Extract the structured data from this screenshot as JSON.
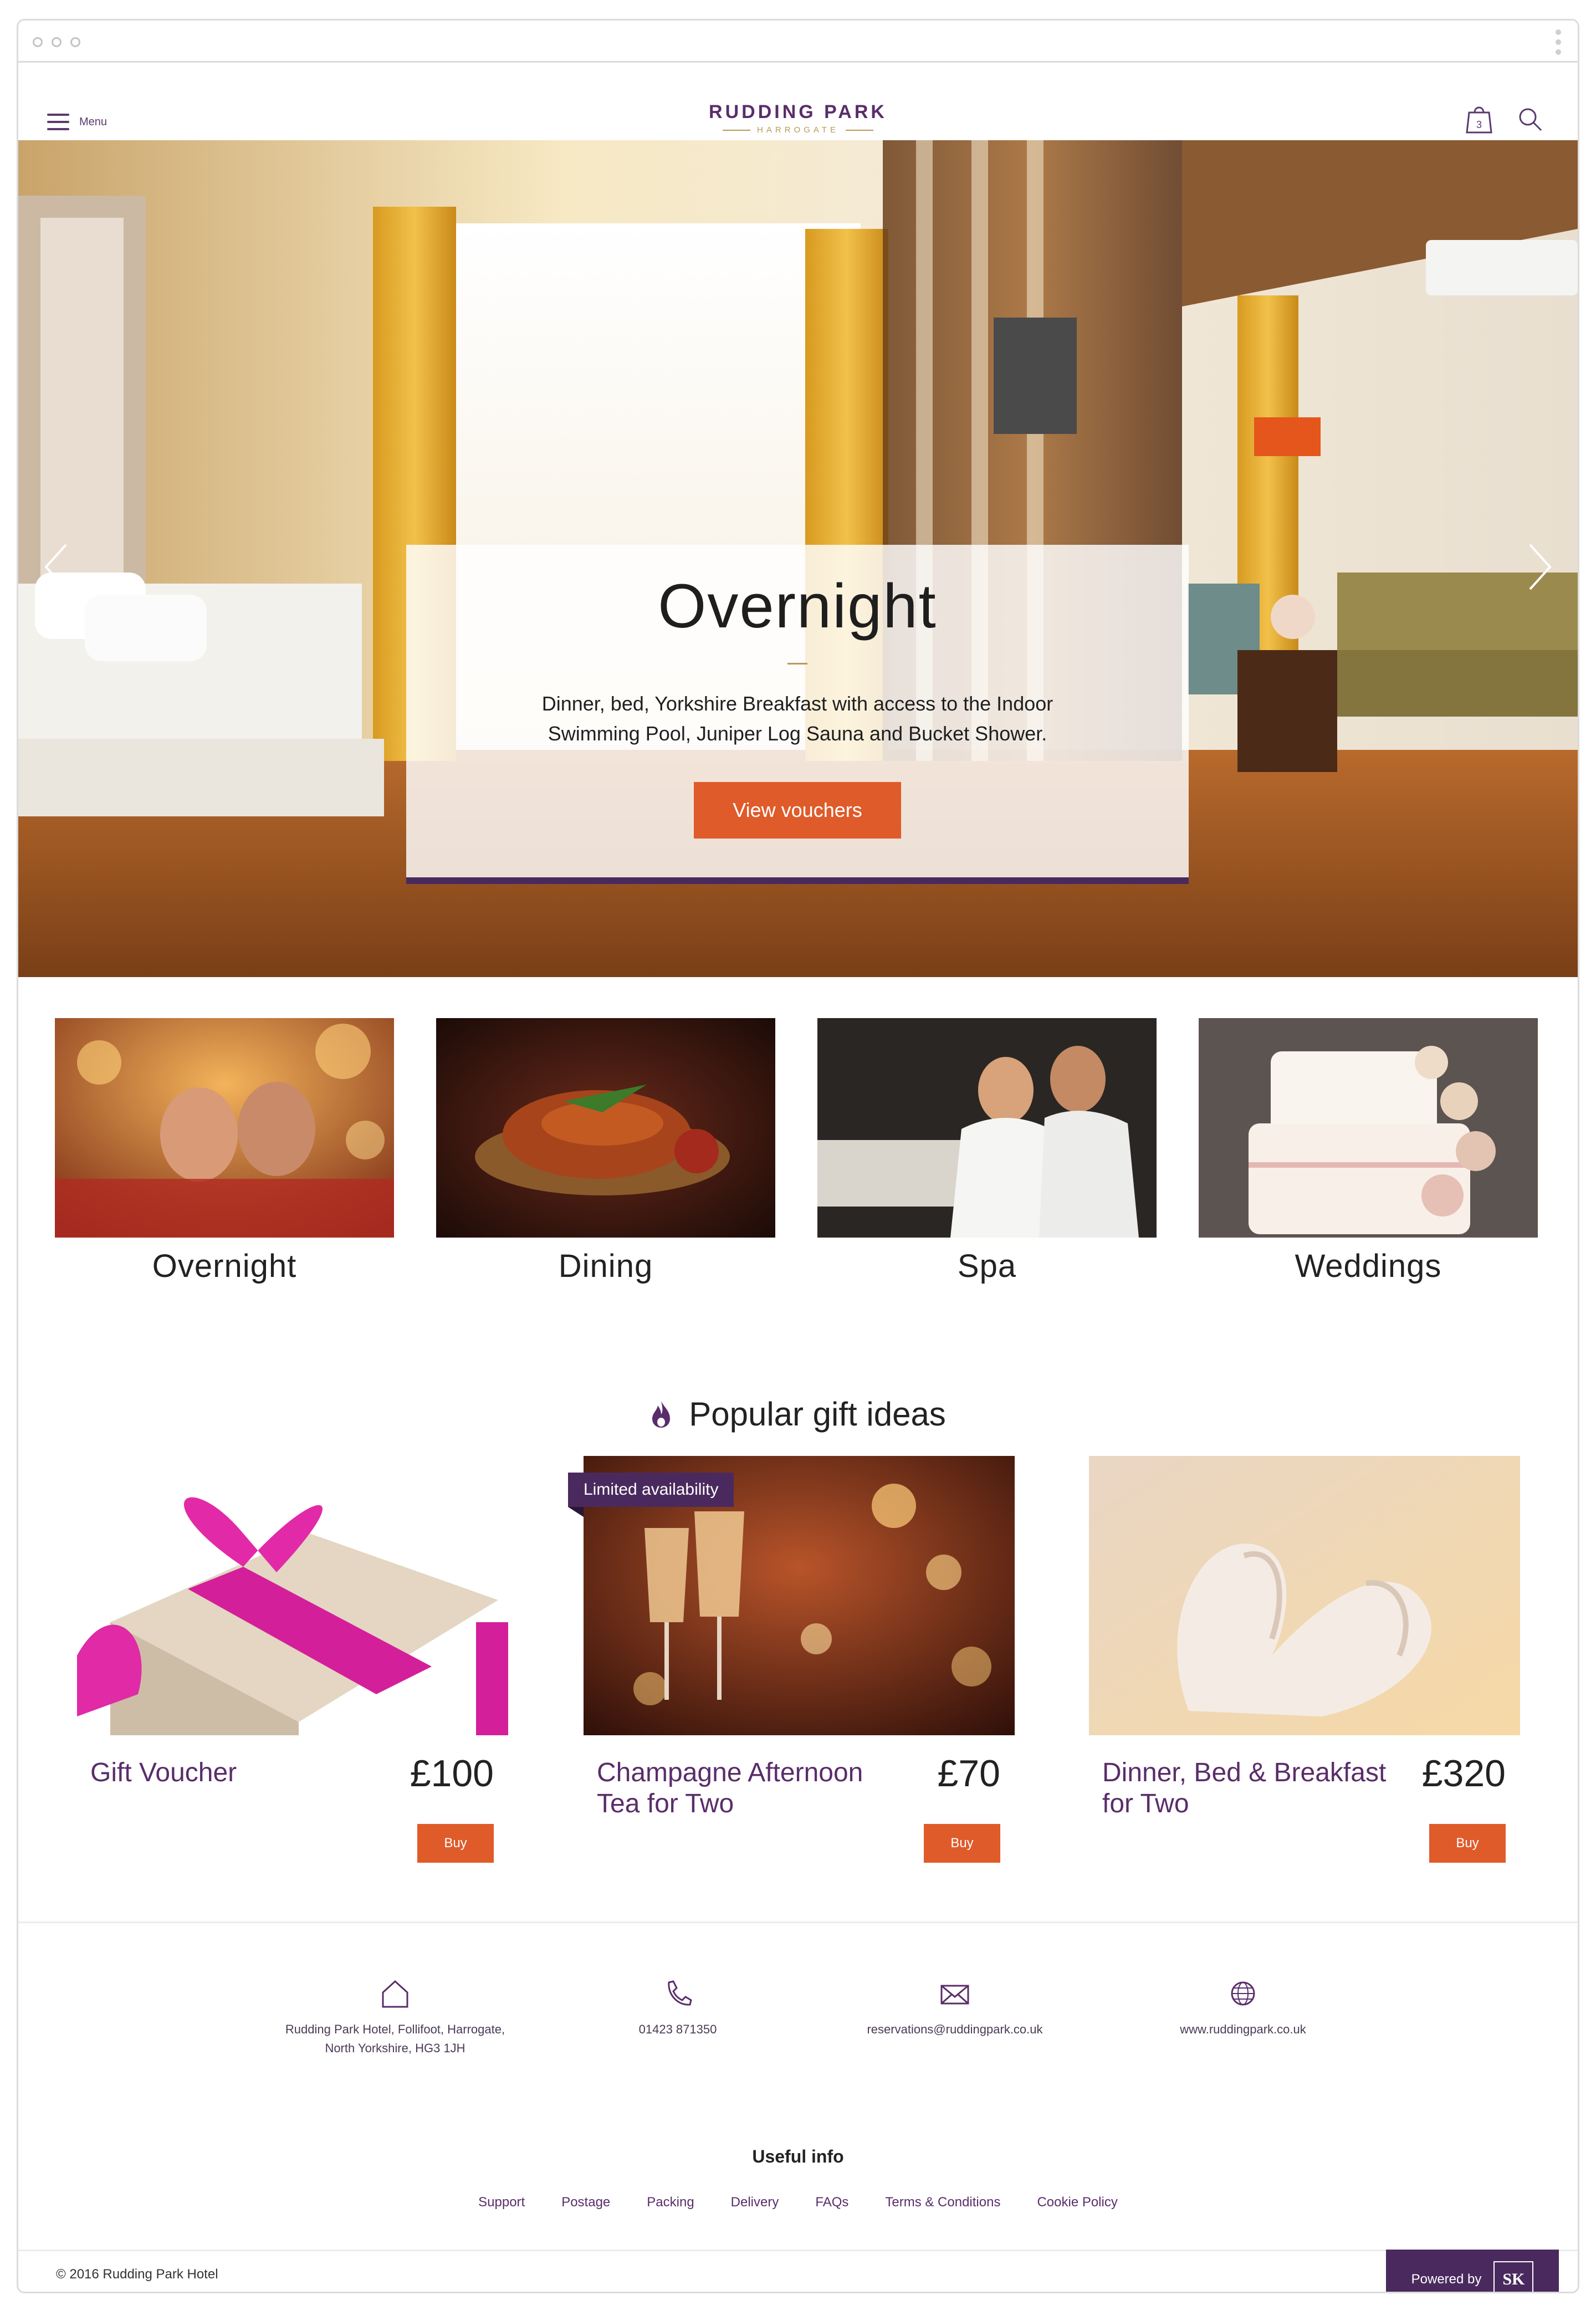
{
  "header": {
    "menu_label": "Menu",
    "logo_main": "RUDDING PARK",
    "logo_sub": "HARROGATE",
    "cart_count": "3"
  },
  "hero": {
    "title": "Overnight",
    "description": "Dinner, bed, Yorkshire Breakfast with access to the Indoor Swimming Pool, Juniper Log Sauna and Bucket Shower.",
    "button_label": "View vouchers"
  },
  "categories": [
    {
      "label": "Overnight"
    },
    {
      "label": "Dining"
    },
    {
      "label": "Spa"
    },
    {
      "label": "Weddings"
    }
  ],
  "popular": {
    "title": "Popular gift ideas",
    "products": [
      {
        "name": "Gift Voucher",
        "price": "£100",
        "buy_label": "Buy",
        "badge": ""
      },
      {
        "name": "Champagne Afternoon Tea for Two",
        "price": "£70",
        "buy_label": "Buy",
        "badge": "Limited availability"
      },
      {
        "name": "Dinner, Bed & Breakfast for Two",
        "price": "£320",
        "buy_label": "Buy",
        "badge": ""
      }
    ]
  },
  "contact": {
    "address_line1": "Rudding Park Hotel, Follifoot, Harrogate,",
    "address_line2": "North Yorkshire, HG3 1JH",
    "phone": "01423 871350",
    "email": "reservations@ruddingpark.co.uk",
    "website": "www.ruddingpark.co.uk"
  },
  "useful_info": {
    "title": "Useful info",
    "links": [
      "Support",
      "Postage",
      "Packing",
      "Delivery",
      "FAQs",
      "Terms & Conditions",
      "Cookie Policy"
    ]
  },
  "footer": {
    "copyright": "© 2016   Rudding Park Hotel",
    "powered_by": "Powered by",
    "powered_logo": "SK"
  },
  "colors": {
    "brand_purple": "#4a2a5e",
    "accent_orange": "#df5b2a",
    "gold": "#b99a55"
  }
}
